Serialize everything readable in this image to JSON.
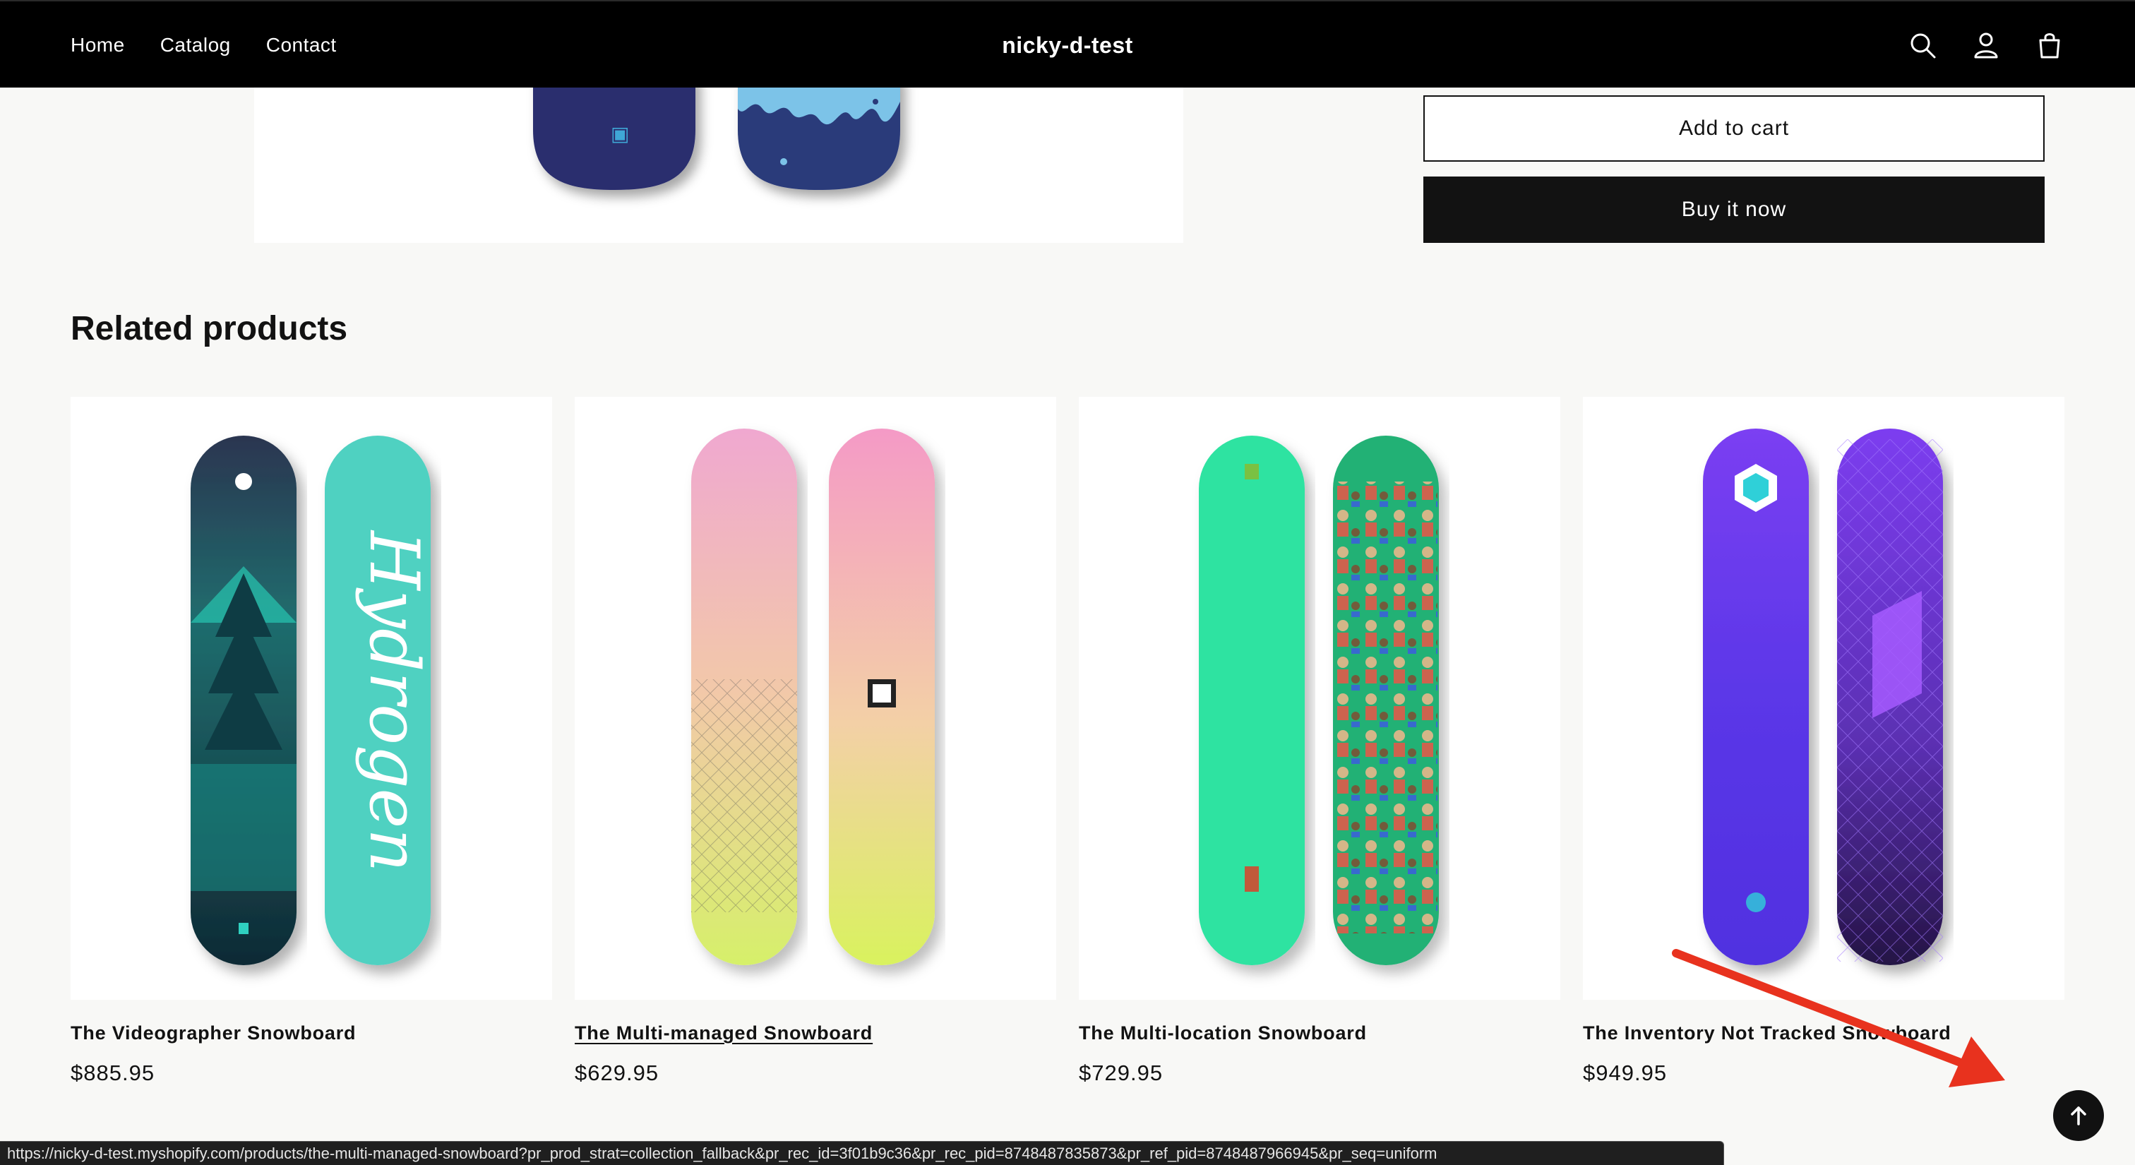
{
  "header": {
    "nav": [
      "Home",
      "Catalog",
      "Contact"
    ],
    "store_name": "nicky-d-test",
    "icons": [
      "search-icon",
      "account-icon",
      "cart-icon"
    ]
  },
  "product": {
    "add_to_cart": "Add to cart",
    "buy_now": "Buy it now"
  },
  "related": {
    "title": "Related products",
    "products": [
      {
        "title": "The Videographer Snowboard",
        "price": "$885.95"
      },
      {
        "title": "The Multi-managed Snowboard",
        "price": "$629.95"
      },
      {
        "title": "The Multi-location Snowboard",
        "price": "$729.95"
      },
      {
        "title": "The Inventory Not Tracked Snowboard",
        "price": "$949.95"
      }
    ]
  },
  "status_bar": {
    "url": "https://nicky-d-test.myshopify.com/products/the-multi-managed-snowboard?pr_prod_strat=collection_fallback&pr_rec_id=3f01b9c36&pr_rec_pid=8748487835873&pr_ref_pid=8748487966945&pr_seq=uniform"
  },
  "colors": {
    "header_bg": "#000000",
    "page_bg": "#f8f8f6",
    "button_dark": "#121212",
    "annotation_arrow": "#e8321e"
  }
}
